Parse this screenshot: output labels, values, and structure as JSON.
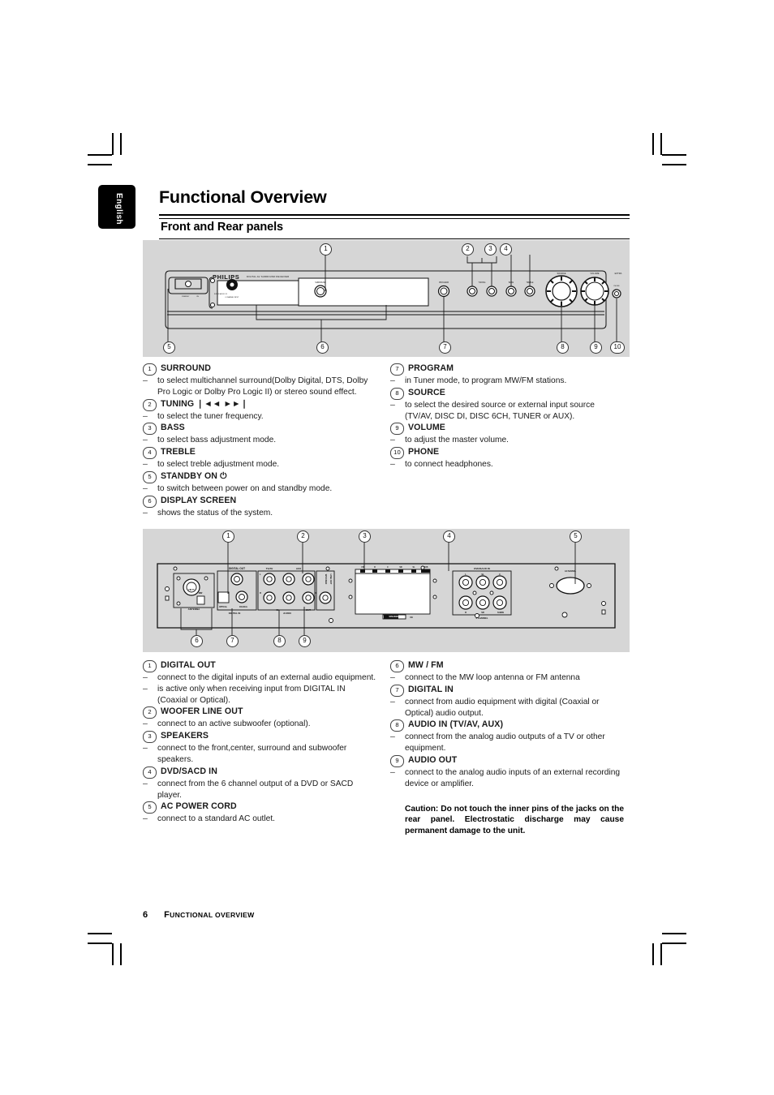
{
  "page": {
    "language_tab": "English",
    "title": "Functional Overview",
    "section_title": "Front and Rear panels",
    "footer_page_number": "6",
    "footer_title_first": "F",
    "footer_title_rest": "UNCTIONAL OVERVIEW"
  },
  "front_panel_figure": {
    "brand": "PHILIPS",
    "model_line": "DIGITAL AV SURROUND RECEIVER",
    "logos": [
      "SACD SUPER AUDIO CD",
      "6 CHANNEL INPUT"
    ],
    "standby_label": "STANDBY ON",
    "button_labels": [
      "SURROUND",
      "PROGRAM",
      "TUNING",
      "BASS",
      "TREBLE"
    ],
    "knob_labels": [
      "SOURCE",
      "VOLUME"
    ],
    "jack_label": "PHONE",
    "extra_label": "EXTRA",
    "callouts_top": [
      "1",
      "2",
      "3",
      "4"
    ],
    "callouts_bottom": [
      "5",
      "6",
      "7",
      "8",
      "9",
      "10"
    ]
  },
  "rear_panel_figure": {
    "labels": [
      "DIGITAL OUT",
      "WOOFER LINE OUT",
      "TV/AV",
      "AUX",
      "FM 75",
      "ANTENNA",
      "MW",
      "OPTICAL",
      "COAXIAL",
      "DIGITAL IN",
      "AUDIO",
      "IN",
      "OUT",
      "DVD/SACD IN",
      "6 CHANNEL",
      "AC MAINS~",
      "SPEAKERS 8"
    ],
    "speaker_terminals": [
      "FR",
      "R",
      "C",
      "SR",
      "SL",
      "SUB"
    ],
    "dvd_in_terminals": [
      "L",
      "SL",
      "C",
      "R",
      "SR",
      "SUBW"
    ],
    "callouts_top": [
      "1",
      "2",
      "3",
      "4",
      "5"
    ],
    "callouts_bottom": [
      "6",
      "7",
      "8",
      "9"
    ]
  },
  "front_panel_items_left": [
    {
      "num": "1",
      "title": "SURROUND",
      "bullets": [
        "to select multichannel surround(Dolby Digital, DTS, Dolby Pro Logic or Dolby Pro Logic II) or stereo sound effect."
      ]
    },
    {
      "num": "2",
      "title": "TUNING ❘◄◄  ►►❘",
      "bullets": [
        "to select the tuner frequency."
      ]
    },
    {
      "num": "3",
      "title": "BASS",
      "bullets": [
        "to select bass adjustment mode."
      ]
    },
    {
      "num": "4",
      "title": "TREBLE",
      "bullets": [
        "to select treble adjustment mode."
      ]
    },
    {
      "num": "5",
      "title": "STANDBY ON ⏻",
      "bullets": [
        "to switch between power on and standby mode."
      ]
    },
    {
      "num": "6",
      "title": "DISPLAY SCREEN",
      "bullets": [
        "shows the status of the system."
      ]
    }
  ],
  "front_panel_items_right": [
    {
      "num": "7",
      "title": "PROGRAM",
      "bullets": [
        "in Tuner mode, to program MW/FM stations."
      ]
    },
    {
      "num": "8",
      "title": "SOURCE",
      "bullets": [
        "to select the desired source or external input source (TV/AV, DISC DI, DISC 6CH, TUNER or AUX)."
      ]
    },
    {
      "num": "9",
      "title": "VOLUME",
      "bullets": [
        "to adjust the master volume."
      ]
    },
    {
      "num": "10",
      "title": "PHONE",
      "bullets": [
        "to connect headphones."
      ]
    }
  ],
  "rear_panel_items_left": [
    {
      "num": "1",
      "title": "DIGITAL OUT",
      "bullets": [
        "connect to the digital inputs of an external audio equipment.",
        "is active only when receiving input from DIGITAL IN (Coaxial or Optical)."
      ]
    },
    {
      "num": "2",
      "title": "WOOFER LINE OUT",
      "bullets": [
        "connect to an active subwoofer (optional)."
      ]
    },
    {
      "num": "3",
      "title": "SPEAKERS",
      "bullets": [
        "connect to the front,center, surround and subwoofer speakers."
      ]
    },
    {
      "num": "4",
      "title": "DVD/SACD IN",
      "bullets": [
        "connect from the 6 channel output of a DVD or SACD player."
      ]
    },
    {
      "num": "5",
      "title": "AC POWER CORD",
      "bullets": [
        "connect to a standard AC outlet."
      ]
    }
  ],
  "rear_panel_items_right": [
    {
      "num": "6",
      "title": "MW / FM",
      "bullets": [
        "connect to the MW loop antenna or FM antenna"
      ]
    },
    {
      "num": "7",
      "title": "DIGITAL IN",
      "bullets": [
        "connect from audio equipment with digital (Coaxial or Optical) audio output."
      ]
    },
    {
      "num": "8",
      "title": "AUDIO IN (TV/AV, AUX)",
      "bullets": [
        "connect from the analog audio outputs of a TV or other equipment."
      ]
    },
    {
      "num": "9",
      "title": "AUDIO OUT",
      "bullets": [
        "connect to the analog audio inputs of an external recording device or amplifier."
      ]
    }
  ],
  "caution_note": "Caution: Do not touch the inner pins of the jacks on the rear panel. Electrostatic discharge may cause permanent damage to the unit.",
  "colors": {
    "figure_background": "#d6d6d6",
    "text": "#1a1a1a",
    "rule": "#000000",
    "tab_background": "#000000"
  }
}
